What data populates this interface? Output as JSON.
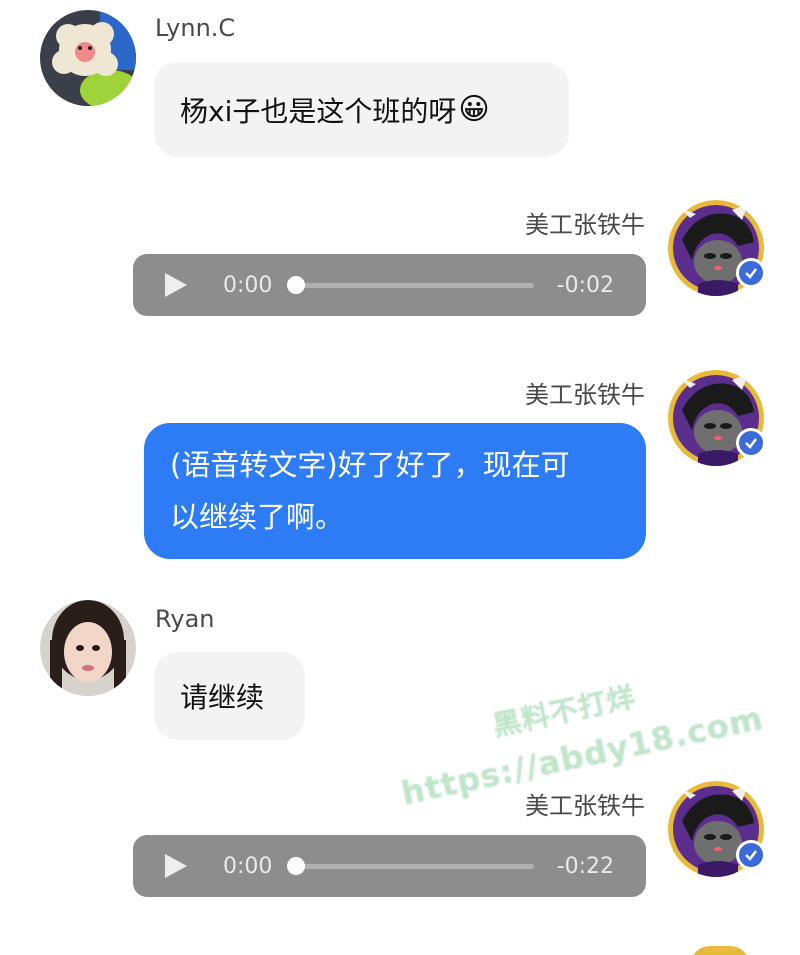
{
  "messages": [
    {
      "sender": "Lynn.C",
      "text": "杨xi子也是这个班的呀"
    },
    {
      "sender": "美工张铁牛",
      "audio": {
        "current": "0:00",
        "remaining": "-0:02"
      }
    },
    {
      "sender": "美工张铁牛",
      "line1": "(语音转文字)好了好了，现在可",
      "line2": "以继续了啊。"
    },
    {
      "sender": "Ryan",
      "text": "请继续"
    },
    {
      "sender": "美工张铁牛",
      "audio": {
        "current": "0:00",
        "remaining": "-0:22"
      }
    }
  ],
  "emoji": "😀",
  "watermark": {
    "line1": "黑料不打烊",
    "line2": "https://abdy18.com"
  },
  "colors": {
    "bubble_right": "#2d7cf6",
    "bubble_left": "#f3f3f3",
    "audio_bg": "#8d8d8d",
    "badge": "#3b6bd8"
  }
}
